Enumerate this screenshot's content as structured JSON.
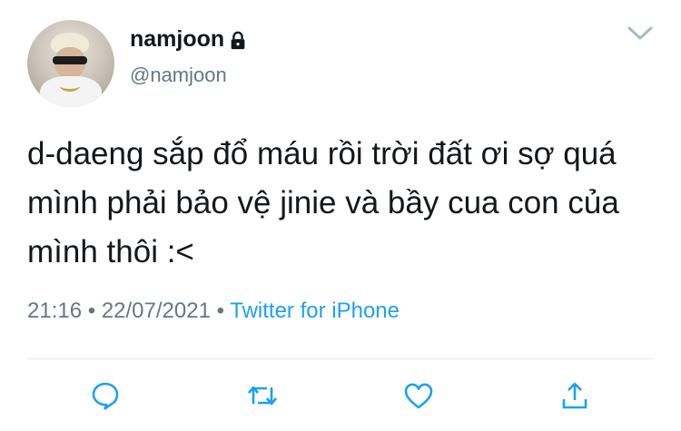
{
  "tweet": {
    "display_name": "namjoon",
    "handle": "@namjoon",
    "protected_icon": "lock-icon",
    "text": "d-daeng sắp đổ máu rồi trời đất ơi sợ quá mình phải bảo vệ jinie và bầy cua con của mình thôi :<",
    "time": "21:16",
    "separator": "•",
    "date": "22/07/2021",
    "source": "Twitter for iPhone"
  },
  "icons": {
    "menu": "chevron-down-icon",
    "reply": "reply-icon",
    "retweet": "retweet-icon",
    "like": "heart-icon",
    "share": "share-icon"
  },
  "colors": {
    "text": "#14171a",
    "secondary": "#657786",
    "link": "#1da1f2",
    "icon": "#1da1f2",
    "divider": "#e1e8ed"
  }
}
